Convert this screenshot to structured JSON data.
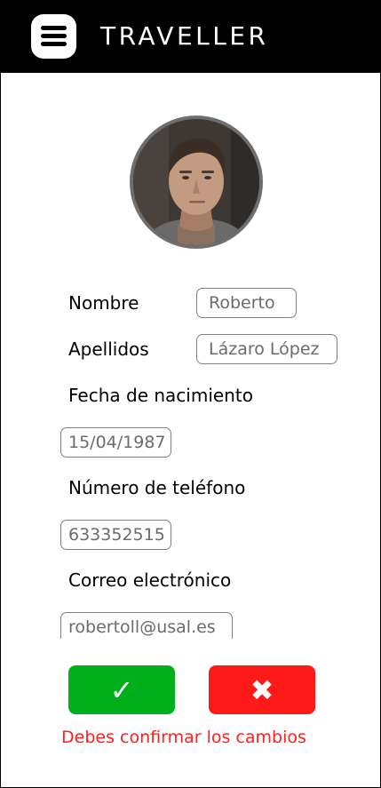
{
  "header": {
    "title": "TRAVELLER",
    "menu_icon": "hamburger-menu-icon"
  },
  "profile": {
    "avatar_icon": "user-photo"
  },
  "form": {
    "nombre_label": "Nombre",
    "nombre_value": "Roberto",
    "apellidos_label": "Apellidos",
    "apellidos_value": "Lázaro López",
    "fecha_label": "Fecha de nacimiento",
    "fecha_value": "15/04/1987",
    "telefono_label": "Número de teléfono",
    "telefono_value": "633352515",
    "correo_label": "Correo electrónico",
    "correo_value": "robertoll@usal.es"
  },
  "actions": {
    "confirm_glyph": "✓",
    "cancel_glyph": "✖",
    "confirm_color": "#00b01a",
    "cancel_color": "#ff1a1a"
  },
  "status": {
    "message": "Debes confirmar los cambios",
    "color": "#ff2020"
  }
}
